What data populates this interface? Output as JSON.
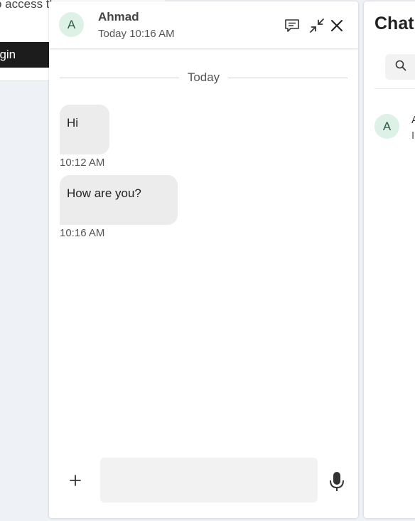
{
  "background_page": {
    "text": "o access th",
    "login_label": "ogin"
  },
  "chat_window": {
    "contact": {
      "avatar_initial": "A",
      "name": "Ahmad",
      "status": "Today 10:16 AM"
    },
    "header_icons": [
      "comment-icon",
      "minimize-icon",
      "close-icon"
    ],
    "date_divider": "Today",
    "messages": [
      {
        "text": "Hi",
        "time": "10:12 AM"
      },
      {
        "text": "How are you?",
        "time": "10:16 AM"
      }
    ],
    "composer": {
      "add_label": "+",
      "input_value": "",
      "input_placeholder": "",
      "mic_icon": "microphone-icon"
    }
  },
  "chats_panel": {
    "title": "Chat",
    "search_icon": "search-icon",
    "items": [
      {
        "avatar_initial": "A",
        "name": "A",
        "preview": "I"
      }
    ]
  },
  "colors": {
    "avatar_bg": "#ddf1e6",
    "bubble_bg": "#ececec",
    "page_bg": "#eef2f6",
    "login_bg": "#1c1c1c"
  }
}
